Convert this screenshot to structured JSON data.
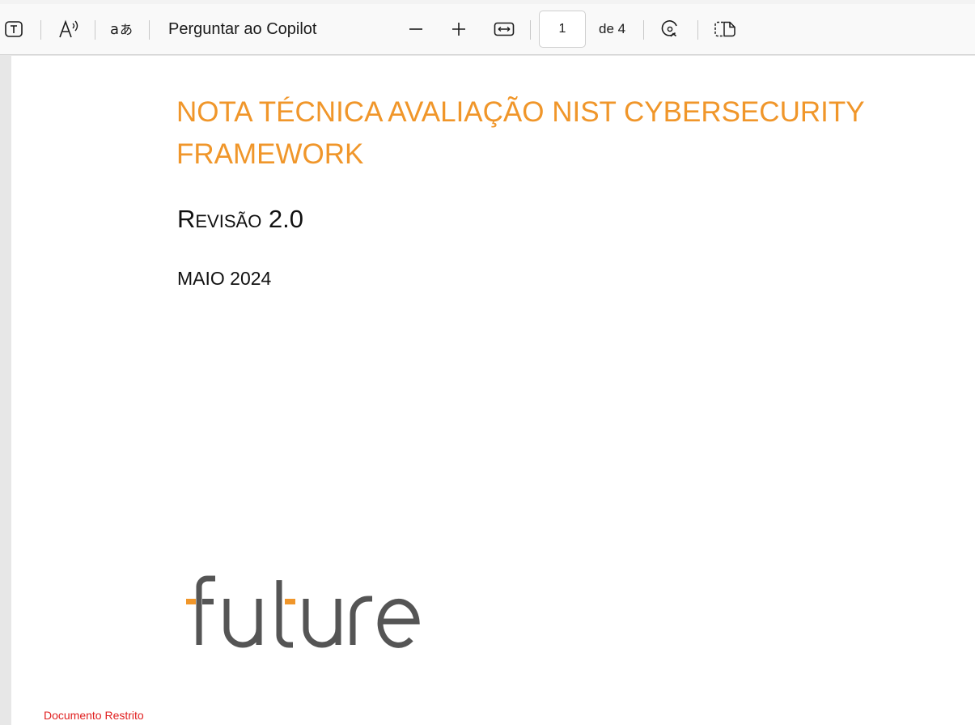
{
  "toolbar": {
    "copilot_label": "Perguntar ao Copilot",
    "page_number": "1",
    "page_of": "de 4",
    "icons": {
      "text": "text-tool-icon",
      "read_aloud": "read-aloud-icon",
      "translate": "translate-icon",
      "zoom_out": "zoom-out-icon",
      "zoom_in": "zoom-in-icon",
      "fit_width": "fit-width-icon",
      "rotate": "rotate-icon",
      "page_view": "page-view-icon"
    }
  },
  "document": {
    "title": "NOTA TÉCNICA AVALIAÇÃO NIST CYBERSECURITY FRAMEWORK",
    "revision": "Revisão 2.0",
    "date": "MAIO 2024",
    "logo_text": "future",
    "footer_restricted": "Documento Restrito"
  },
  "colors": {
    "title": "#f0962a",
    "logo_gray": "#555555",
    "logo_accent": "#f0962a",
    "restricted": "#e01f1f"
  }
}
